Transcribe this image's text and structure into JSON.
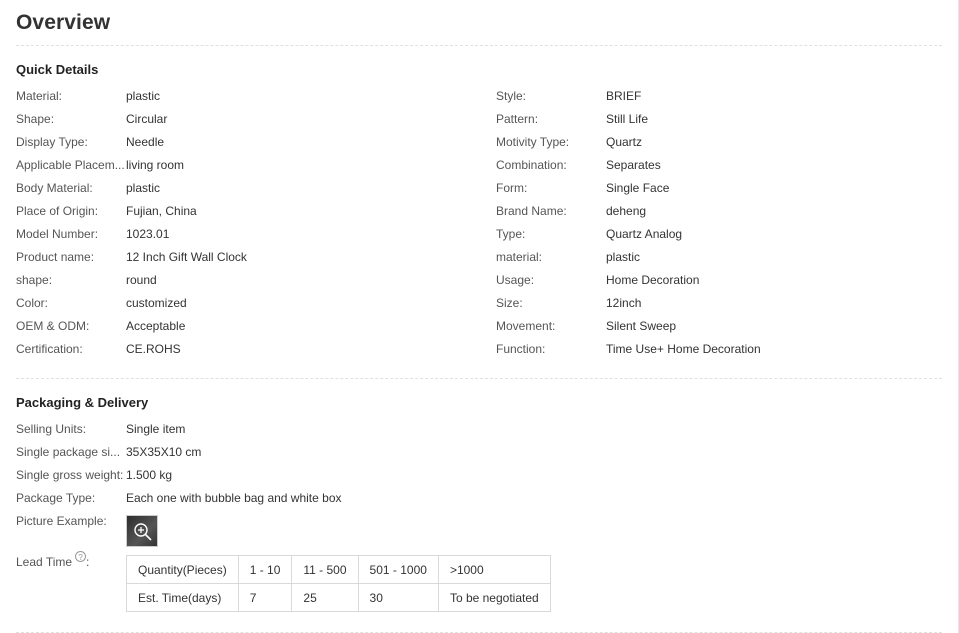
{
  "title": "Overview",
  "quick_details": {
    "heading": "Quick Details",
    "left": [
      {
        "label": "Material:",
        "value": "plastic"
      },
      {
        "label": "Shape:",
        "value": "Circular"
      },
      {
        "label": "Display Type:",
        "value": "Needle"
      },
      {
        "label": "Applicable Placem...",
        "value": "living room"
      },
      {
        "label": "Body Material:",
        "value": "plastic"
      },
      {
        "label": "Place of Origin:",
        "value": "Fujian, China"
      },
      {
        "label": "Model Number:",
        "value": "1023.01"
      },
      {
        "label": "Product name:",
        "value": "12 Inch Gift Wall Clock"
      },
      {
        "label": "shape:",
        "value": "round"
      },
      {
        "label": "Color:",
        "value": "customized"
      },
      {
        "label": "OEM & ODM:",
        "value": "Acceptable"
      },
      {
        "label": "Certification:",
        "value": "CE.ROHS"
      }
    ],
    "right": [
      {
        "label": "Style:",
        "value": "BRIEF"
      },
      {
        "label": "Pattern:",
        "value": "Still Life"
      },
      {
        "label": "Motivity Type:",
        "value": "Quartz"
      },
      {
        "label": "Combination:",
        "value": "Separates"
      },
      {
        "label": "Form:",
        "value": "Single Face"
      },
      {
        "label": "Brand Name:",
        "value": "deheng"
      },
      {
        "label": "Type:",
        "value": "Quartz Analog"
      },
      {
        "label": "material:",
        "value": "plastic"
      },
      {
        "label": "Usage:",
        "value": "Home Decoration"
      },
      {
        "label": "Size:",
        "value": "12inch"
      },
      {
        "label": "Movement:",
        "value": "Silent Sweep"
      },
      {
        "label": "Function:",
        "value": "Time Use+ Home Decoration"
      }
    ]
  },
  "packaging": {
    "heading": "Packaging & Delivery",
    "rows": [
      {
        "label": "Selling Units:",
        "value": "Single item"
      },
      {
        "label": "Single package si...",
        "value": "35X35X10 cm"
      },
      {
        "label": "Single gross weight:",
        "value": "1.500 kg"
      },
      {
        "label": "Package Type:",
        "value": "Each one with bubble bag and white box"
      }
    ],
    "picture_label": "Picture Example:",
    "lead_time_label": "Lead Time",
    "lead_time_help": "?",
    "lead_table": [
      [
        "Quantity(Pieces)",
        "1 - 10",
        "11 - 500",
        "501 - 1000",
        ">1000"
      ],
      [
        "Est. Time(days)",
        "7",
        "25",
        "30",
        "To be negotiated"
      ]
    ]
  }
}
